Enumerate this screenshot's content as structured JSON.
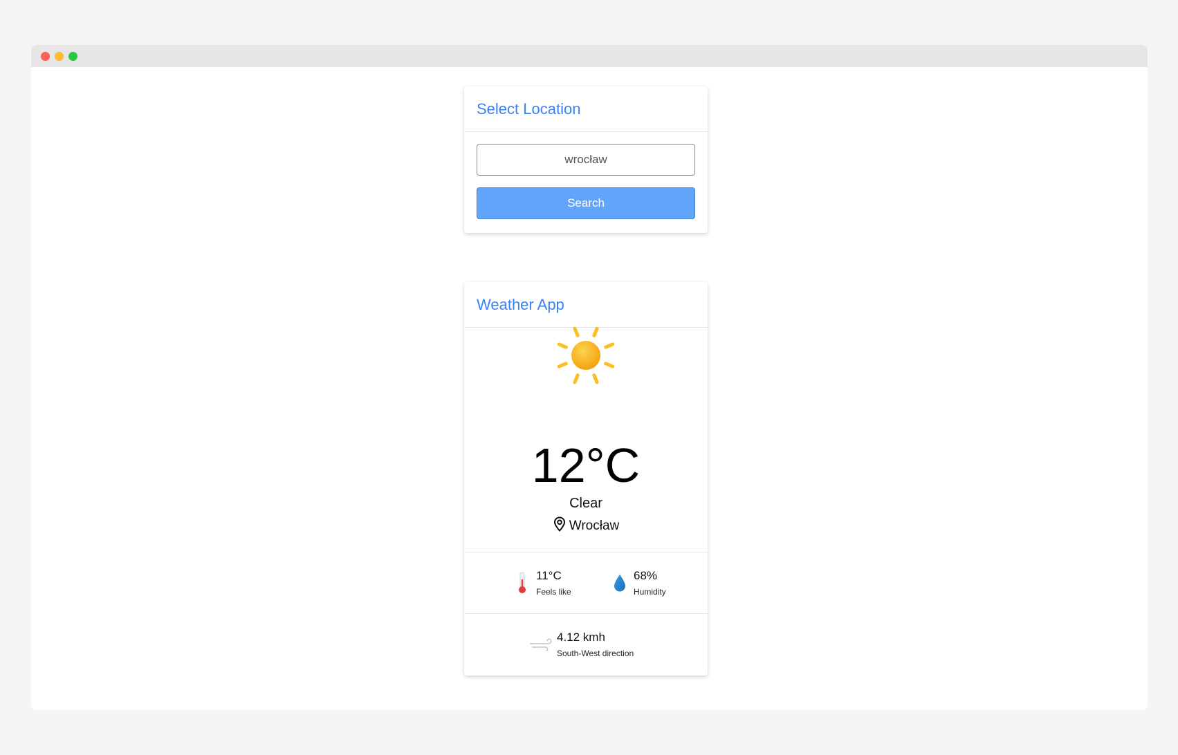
{
  "location_card": {
    "title": "Select Location",
    "search_value": "wrocław",
    "search_button_label": "Search"
  },
  "weather_card": {
    "title": "Weather App",
    "icon": "sun-icon",
    "temperature": "12°C",
    "condition": "Clear",
    "location": "Wrocław",
    "feels_like": {
      "value": "11°C",
      "label": "Feels like"
    },
    "humidity": {
      "value": "68%",
      "label": "Humidity"
    },
    "wind": {
      "value": "4.12 kmh",
      "label": "South-West direction"
    }
  },
  "colors": {
    "accent": "#3b82f6",
    "button": "#60a5fa",
    "sun": "#fbbf24"
  }
}
